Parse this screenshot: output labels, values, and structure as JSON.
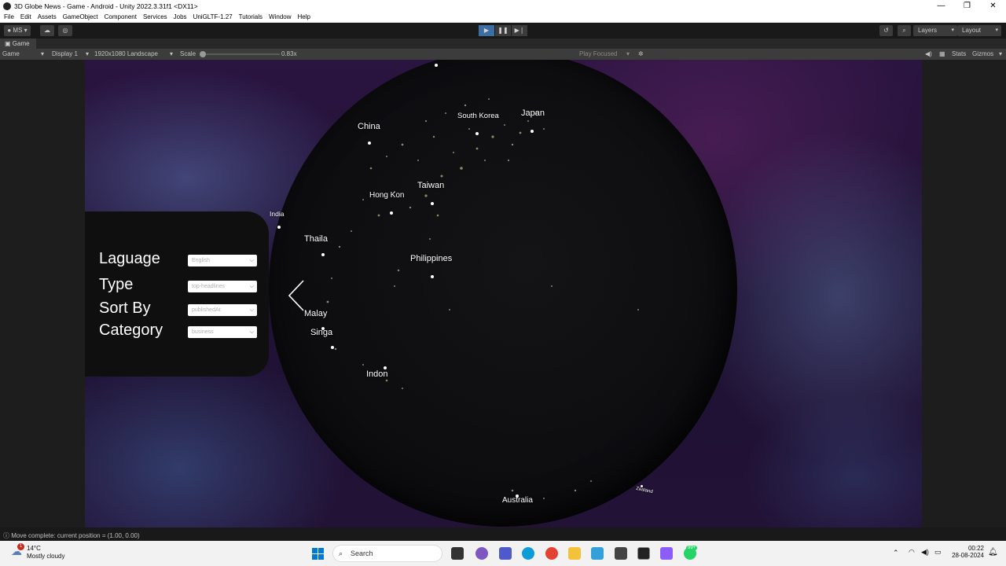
{
  "window": {
    "title": "3D Globe News - Game - Android - Unity 2022.3.31f1 <DX11>",
    "controls": [
      "—",
      "❐",
      "✕"
    ]
  },
  "menu": [
    "File",
    "Edit",
    "Assets",
    "GameObject",
    "Component",
    "Services",
    "Jobs",
    "UniGLTF-1.27",
    "Tutorials",
    "Window",
    "Help"
  ],
  "toolbar": {
    "account": "MS",
    "layers": "Layers",
    "layout": "Layout"
  },
  "tab": {
    "label": "Game"
  },
  "gamebar": {
    "mode": "Game",
    "display": "Display 1",
    "resolution": "1920x1080 Landscape",
    "scale_label": "Scale",
    "scale_value": "0.83x",
    "play_focused": "Play Focused",
    "stats": "Stats",
    "gizmos": "Gizmos"
  },
  "panel": {
    "rows": [
      {
        "label": "Laguage",
        "value": "English"
      },
      {
        "label": "Type",
        "value": "top-headlines"
      },
      {
        "label": "Sort By",
        "value": "publishedAt"
      },
      {
        "label": "Category",
        "value": "business"
      }
    ]
  },
  "globe_labels": [
    "China",
    "South Korea",
    "Japan",
    "Hong Kon",
    "Taiwan",
    "India",
    "Thaila",
    "Philippines",
    "Malay",
    "Singa",
    "Indon",
    "Australia",
    "Zealand"
  ],
  "status": {
    "text": "Move complete: current position = (1.00, 0.00)"
  },
  "taskbar": {
    "temp": "14°C",
    "condition": "Mostly cloudy",
    "search": "Search",
    "time": "00:22",
    "date": "28-08-2024",
    "badge": "99+",
    "weather_badge": "1"
  }
}
